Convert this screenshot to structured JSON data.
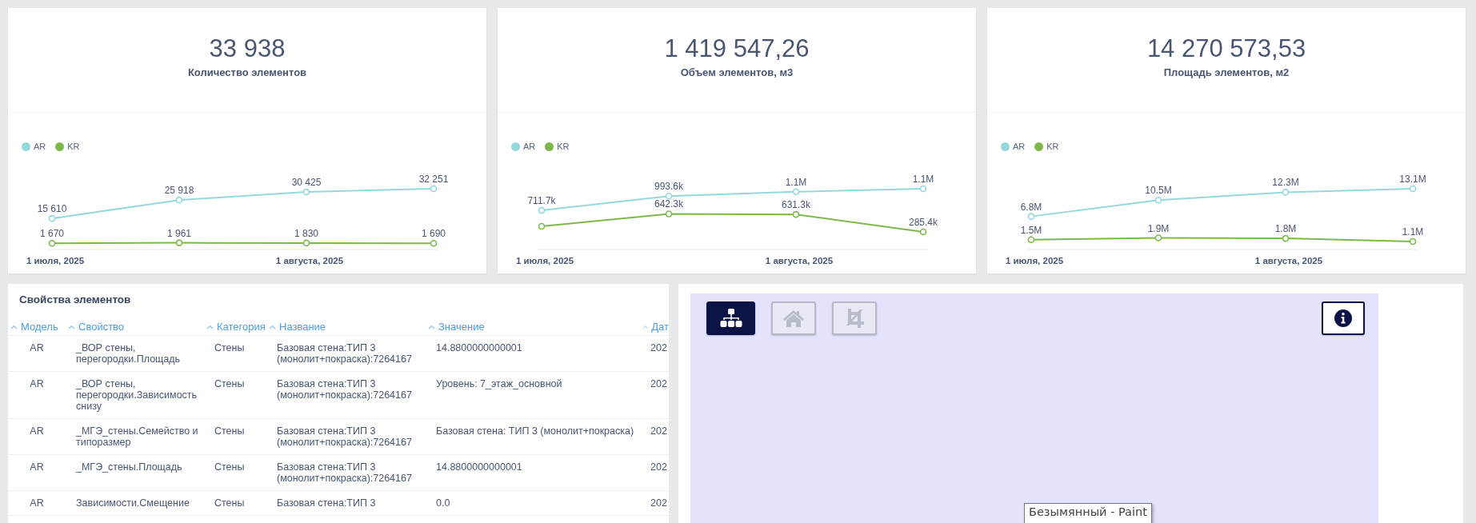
{
  "stat_cards": [
    {
      "value": "33 938",
      "label": "Количество элементов",
      "chart_data": {
        "type": "line",
        "categories": [
          "1 июля, 2025",
          null,
          "1 августа, 2025",
          null
        ],
        "legend": "top-left",
        "data_labels": true,
        "series": [
          {
            "name": "AR",
            "color": "#93d9dc",
            "marker": "circle",
            "values": [
              15610,
              25918,
              30425,
              32251
            ],
            "value_labels": [
              "15 610",
              "25 918",
              "30 425",
              "32 251"
            ]
          },
          {
            "name": "KR",
            "color": "#7cb94a",
            "marker": "circle",
            "values": [
              1670,
              1961,
              1830,
              1690
            ],
            "value_labels": [
              "1 670",
              "1 961",
              "1 830",
              "1 690"
            ]
          }
        ]
      }
    },
    {
      "value": "1 419 547,26",
      "label": "Объем элементов, м3",
      "chart_data": {
        "type": "line",
        "categories": [
          "1 июля, 2025",
          null,
          "1 августа, 2025",
          null
        ],
        "legend": "top-left",
        "data_labels": true,
        "series": [
          {
            "name": "AR",
            "color": "#93d9dc",
            "marker": "circle",
            "values": [
              711700,
              993600,
              1081000,
              1141000
            ],
            "value_labels": [
              "711.7k",
              "993.6k",
              "1.1M",
              "1.1M"
            ]
          },
          {
            "name": "KR",
            "color": "#7cb94a",
            "marker": "circle",
            "values": [
              397000,
              642300,
              631300,
              285400
            ],
            "value_labels": [
              null,
              "642.3k",
              "631.3k",
              "285.4k"
            ]
          }
        ]
      }
    },
    {
      "value": "14 270 573,53",
      "label": "Площадь элементов, м2",
      "chart_data": {
        "type": "line",
        "categories": [
          "1 июля, 2025",
          null,
          "1 августа, 2025",
          null
        ],
        "legend": "top-left",
        "data_labels": true,
        "series": [
          {
            "name": "AR",
            "color": "#93d9dc",
            "marker": "circle",
            "values": [
              6800000,
              10500000,
              12300000,
              13100000
            ],
            "value_labels": [
              "6.8M",
              "10.5M",
              "12.3M",
              "13.1M"
            ]
          },
          {
            "name": "KR",
            "color": "#7cb94a",
            "marker": "circle",
            "values": [
              1500000,
              1900000,
              1800000,
              1100000
            ],
            "value_labels": [
              "1.5M",
              "1.9M",
              "1.8M",
              "1.1M"
            ]
          }
        ]
      }
    }
  ],
  "properties_table": {
    "title": "Свойства элементов",
    "columns": [
      "Модель",
      "Свойство",
      "Категория",
      "Название",
      "Значение",
      "Дат"
    ],
    "rows": [
      [
        "AR",
        "_ВОР стены, перегородки.Площадь",
        "Стены",
        "Базовая стена:ТИП 3 (монолит+покраска):7264167",
        "14.8800000000001",
        "202"
      ],
      [
        "AR",
        "_ВОР стены, перегородки.Зависимость снизу",
        "Стены",
        "Базовая стена:ТИП 3 (монолит+покраска):7264167",
        "Уровень: 7_этаж_основной",
        "202"
      ],
      [
        "AR",
        "_МГЭ_стены.Семейство и типоразмер",
        "Стены",
        "Базовая стена:ТИП 3 (монолит+покраска):7264167",
        "Базовая стена: ТИП 3 (монолит+покраска)",
        "202"
      ],
      [
        "AR",
        "_МГЭ_стены.Площадь",
        "Стены",
        "Базовая стена:ТИП 3 (монолит+покраска):7264167",
        "14.8800000000001",
        "202"
      ],
      [
        "AR",
        "Зависимости.Смещение",
        "Стены",
        "Базовая стена:ТИП 3",
        "0.0",
        "202"
      ]
    ]
  },
  "viewer": {
    "toolbar": [
      {
        "kind": "tree",
        "disabled": false
      },
      {
        "kind": "home",
        "disabled": true
      },
      {
        "kind": "crop",
        "disabled": true
      }
    ],
    "info_button": {
      "kind": "info",
      "disabled": false
    }
  },
  "tooltip": "Безымянный - Paint"
}
